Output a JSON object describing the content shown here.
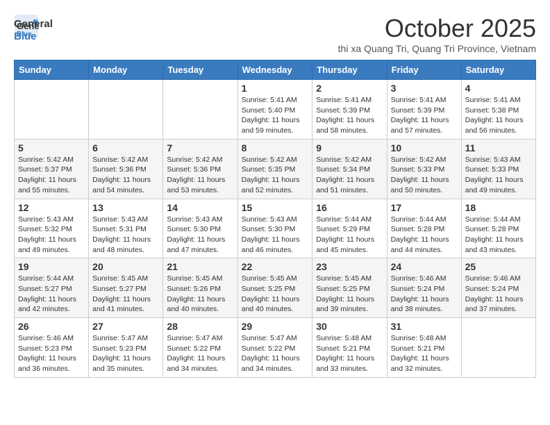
{
  "header": {
    "logo_general": "General",
    "logo_blue": "Blue",
    "month_title": "October 2025",
    "subtitle": "thi xa Quang Tri, Quang Tri Province, Vietnam"
  },
  "days_of_week": [
    "Sunday",
    "Monday",
    "Tuesday",
    "Wednesday",
    "Thursday",
    "Friday",
    "Saturday"
  ],
  "weeks": [
    [
      {
        "day": "",
        "info": ""
      },
      {
        "day": "",
        "info": ""
      },
      {
        "day": "",
        "info": ""
      },
      {
        "day": "1",
        "info": "Sunrise: 5:41 AM\nSunset: 5:40 PM\nDaylight: 11 hours\nand 59 minutes."
      },
      {
        "day": "2",
        "info": "Sunrise: 5:41 AM\nSunset: 5:39 PM\nDaylight: 11 hours\nand 58 minutes."
      },
      {
        "day": "3",
        "info": "Sunrise: 5:41 AM\nSunset: 5:39 PM\nDaylight: 11 hours\nand 57 minutes."
      },
      {
        "day": "4",
        "info": "Sunrise: 5:41 AM\nSunset: 5:38 PM\nDaylight: 11 hours\nand 56 minutes."
      }
    ],
    [
      {
        "day": "5",
        "info": "Sunrise: 5:42 AM\nSunset: 5:37 PM\nDaylight: 11 hours\nand 55 minutes."
      },
      {
        "day": "6",
        "info": "Sunrise: 5:42 AM\nSunset: 5:36 PM\nDaylight: 11 hours\nand 54 minutes."
      },
      {
        "day": "7",
        "info": "Sunrise: 5:42 AM\nSunset: 5:36 PM\nDaylight: 11 hours\nand 53 minutes."
      },
      {
        "day": "8",
        "info": "Sunrise: 5:42 AM\nSunset: 5:35 PM\nDaylight: 11 hours\nand 52 minutes."
      },
      {
        "day": "9",
        "info": "Sunrise: 5:42 AM\nSunset: 5:34 PM\nDaylight: 11 hours\nand 51 minutes."
      },
      {
        "day": "10",
        "info": "Sunrise: 5:42 AM\nSunset: 5:33 PM\nDaylight: 11 hours\nand 50 minutes."
      },
      {
        "day": "11",
        "info": "Sunrise: 5:43 AM\nSunset: 5:33 PM\nDaylight: 11 hours\nand 49 minutes."
      }
    ],
    [
      {
        "day": "12",
        "info": "Sunrise: 5:43 AM\nSunset: 5:32 PM\nDaylight: 11 hours\nand 49 minutes."
      },
      {
        "day": "13",
        "info": "Sunrise: 5:43 AM\nSunset: 5:31 PM\nDaylight: 11 hours\nand 48 minutes."
      },
      {
        "day": "14",
        "info": "Sunrise: 5:43 AM\nSunset: 5:30 PM\nDaylight: 11 hours\nand 47 minutes."
      },
      {
        "day": "15",
        "info": "Sunrise: 5:43 AM\nSunset: 5:30 PM\nDaylight: 11 hours\nand 46 minutes."
      },
      {
        "day": "16",
        "info": "Sunrise: 5:44 AM\nSunset: 5:29 PM\nDaylight: 11 hours\nand 45 minutes."
      },
      {
        "day": "17",
        "info": "Sunrise: 5:44 AM\nSunset: 5:28 PM\nDaylight: 11 hours\nand 44 minutes."
      },
      {
        "day": "18",
        "info": "Sunrise: 5:44 AM\nSunset: 5:28 PM\nDaylight: 11 hours\nand 43 minutes."
      }
    ],
    [
      {
        "day": "19",
        "info": "Sunrise: 5:44 AM\nSunset: 5:27 PM\nDaylight: 11 hours\nand 42 minutes."
      },
      {
        "day": "20",
        "info": "Sunrise: 5:45 AM\nSunset: 5:27 PM\nDaylight: 11 hours\nand 41 minutes."
      },
      {
        "day": "21",
        "info": "Sunrise: 5:45 AM\nSunset: 5:26 PM\nDaylight: 11 hours\nand 40 minutes."
      },
      {
        "day": "22",
        "info": "Sunrise: 5:45 AM\nSunset: 5:25 PM\nDaylight: 11 hours\nand 40 minutes."
      },
      {
        "day": "23",
        "info": "Sunrise: 5:45 AM\nSunset: 5:25 PM\nDaylight: 11 hours\nand 39 minutes."
      },
      {
        "day": "24",
        "info": "Sunrise: 5:46 AM\nSunset: 5:24 PM\nDaylight: 11 hours\nand 38 minutes."
      },
      {
        "day": "25",
        "info": "Sunrise: 5:46 AM\nSunset: 5:24 PM\nDaylight: 11 hours\nand 37 minutes."
      }
    ],
    [
      {
        "day": "26",
        "info": "Sunrise: 5:46 AM\nSunset: 5:23 PM\nDaylight: 11 hours\nand 36 minutes."
      },
      {
        "day": "27",
        "info": "Sunrise: 5:47 AM\nSunset: 5:23 PM\nDaylight: 11 hours\nand 35 minutes."
      },
      {
        "day": "28",
        "info": "Sunrise: 5:47 AM\nSunset: 5:22 PM\nDaylight: 11 hours\nand 34 minutes."
      },
      {
        "day": "29",
        "info": "Sunrise: 5:47 AM\nSunset: 5:22 PM\nDaylight: 11 hours\nand 34 minutes."
      },
      {
        "day": "30",
        "info": "Sunrise: 5:48 AM\nSunset: 5:21 PM\nDaylight: 11 hours\nand 33 minutes."
      },
      {
        "day": "31",
        "info": "Sunrise: 5:48 AM\nSunset: 5:21 PM\nDaylight: 11 hours\nand 32 minutes."
      },
      {
        "day": "",
        "info": ""
      }
    ]
  ]
}
